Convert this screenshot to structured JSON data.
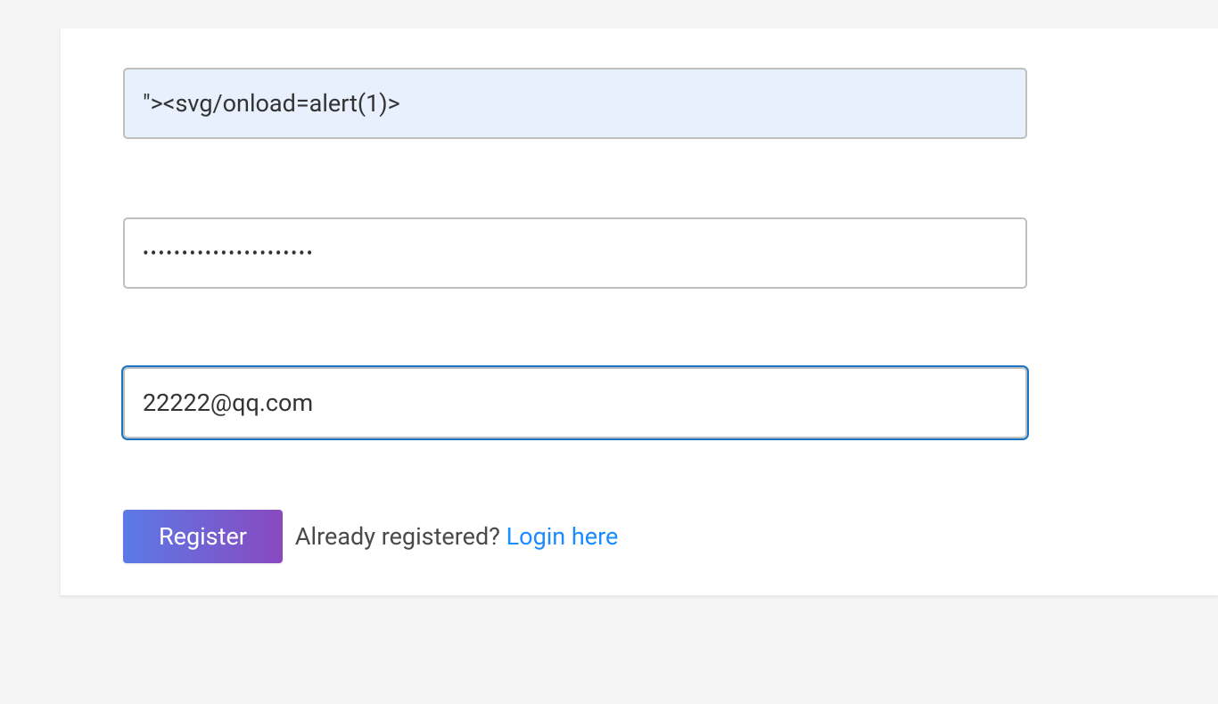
{
  "form": {
    "username": {
      "value": "\"><svg/onload=alert(1)>"
    },
    "password": {
      "value": "••••••••••••••••••••••"
    },
    "email": {
      "value": "22222@qq.com"
    }
  },
  "actions": {
    "register_label": "Register",
    "already_text": "Already registered? ",
    "login_link_text": "Login here"
  }
}
